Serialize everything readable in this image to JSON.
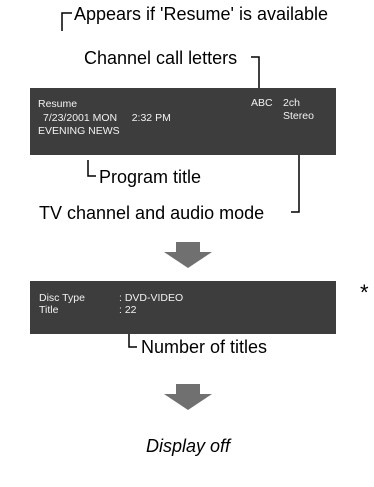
{
  "callouts": {
    "resume_note": "Appears if 'Resume' is available",
    "call_letters": "Channel call letters",
    "program_title": "Program title",
    "tv_channel_audio": "TV channel and audio mode",
    "number_of_titles": "Number of titles",
    "display_off": "Display off"
  },
  "screen1": {
    "resume": "Resume",
    "datetime": "7/23/2001 MON     2:32 PM",
    "program": "EVENING NEWS",
    "station": "ABC",
    "channel": "2ch",
    "audio": "Stereo"
  },
  "screen2": {
    "disc_type_label": "Disc Type",
    "disc_type_value": ": DVD-VIDEO",
    "title_label": "Title",
    "title_value": ": 22"
  },
  "asterisk": "*",
  "colors": {
    "screen_bg": "#3d3d3d",
    "screen_text": "#f2f2f2",
    "arrow": "#707070",
    "line": "#000000"
  }
}
